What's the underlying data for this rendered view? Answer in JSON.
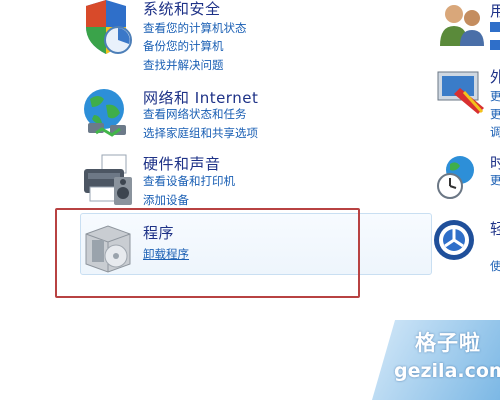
{
  "categories": [
    {
      "id": "system",
      "title": "系统和安全",
      "icon": "shield-chart-icon",
      "links": [
        "查看您的计算机状态",
        "备份您的计算机",
        "查找并解决问题"
      ]
    },
    {
      "id": "network",
      "title": "网络和 Internet",
      "icon": "globe-network-icon",
      "links": [
        "查看网络状态和任务",
        "选择家庭组和共享选项"
      ]
    },
    {
      "id": "hardware",
      "title": "硬件和声音",
      "icon": "printer-speaker-icon",
      "links": [
        "查看设备和打印机",
        "添加设备"
      ]
    },
    {
      "id": "programs",
      "title": "程序",
      "icon": "program-box-icon",
      "links": [
        "卸载程序"
      ]
    }
  ],
  "right_column": {
    "glyphs": [
      "用",
      "外",
      "更",
      "更",
      "调",
      "时",
      "更",
      "轻",
      "使"
    ],
    "icons": [
      "users-icon",
      "appearance-icon",
      "clock-globe-icon",
      "ease-of-access-icon"
    ]
  },
  "watermark": {
    "title": "格子啦",
    "url": "gezila.com"
  },
  "colors": {
    "title": "#1e3287",
    "link": "#1a5fb4",
    "highlight_box": "#b84242"
  }
}
